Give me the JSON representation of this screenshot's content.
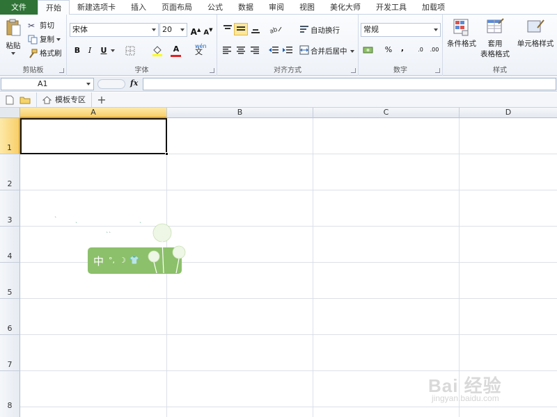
{
  "menu": {
    "tabs": [
      {
        "label": "文件"
      },
      {
        "label": "开始"
      },
      {
        "label": "新建选项卡"
      },
      {
        "label": "插入"
      },
      {
        "label": "页面布局"
      },
      {
        "label": "公式"
      },
      {
        "label": "数据"
      },
      {
        "label": "审阅"
      },
      {
        "label": "视图"
      },
      {
        "label": "美化大师"
      },
      {
        "label": "开发工具"
      },
      {
        "label": "加载项"
      }
    ]
  },
  "ribbon": {
    "clipboard": {
      "label": "剪贴板",
      "paste": "粘贴",
      "cut": "剪切",
      "copy": "复制",
      "format_painter": "格式刷"
    },
    "font": {
      "label": "字体",
      "name": "宋体",
      "size": "20",
      "bold": "B",
      "italic": "I",
      "underline": "U",
      "grow": "A",
      "shrink": "A",
      "font_color": "A",
      "phonetic": "wén"
    },
    "alignment": {
      "label": "对齐方式",
      "wrap": "自动换行",
      "merge": "合并后居中"
    },
    "number": {
      "label": "数字",
      "format": "常规",
      "percent": "%",
      "comma": ",",
      "inc_dec": ".0",
      "dec_dec": ".00"
    },
    "styles": {
      "label": "样式",
      "conditional": "条件格式",
      "table1": "套用",
      "table2": "表格格式",
      "cell": "单元格样式"
    }
  },
  "formula_bar": {
    "name_box": "A1",
    "fx": "fx",
    "value": ""
  },
  "sheet_bar": {
    "tab": "模板专区",
    "add": "+"
  },
  "grid": {
    "columns": [
      "A",
      "B",
      "C",
      "D"
    ],
    "rows": [
      "1",
      "2",
      "3",
      "4",
      "5",
      "6",
      "7",
      "8"
    ],
    "selected_cell": "A1"
  },
  "ime": {
    "char": "中",
    "s1": "°,",
    "s2": "☽",
    "s3": "👕"
  },
  "watermark": {
    "line1": "Bai 经验",
    "line2": "jingyan.baidu.com"
  }
}
